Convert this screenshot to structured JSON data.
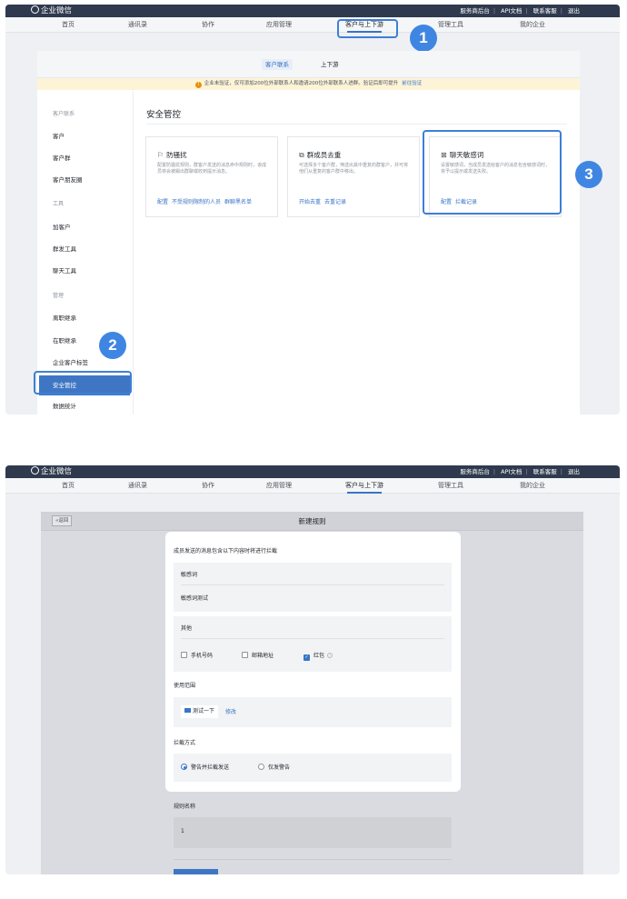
{
  "app": {
    "name": "企业微信",
    "top_links": [
      "服务商后台",
      "API文档",
      "联系客服",
      "退出"
    ],
    "nav": [
      "首页",
      "通讯录",
      "协作",
      "应用管理",
      "客户与上下游",
      "管理工具",
      "我的企业"
    ]
  },
  "screen1": {
    "subtabs": [
      "客户联系",
      "上下游"
    ],
    "warning": {
      "text": "企业未验证，仅可添加200位外部联系人和邀请200位外部联系人进群。验证后即可提升",
      "link": "前往验证",
      "icon": "warning-icon"
    },
    "sidebar": [
      {
        "label": "客户联系",
        "group": true
      },
      {
        "label": "客户",
        "group": false
      },
      {
        "label": "客户群",
        "group": false
      },
      {
        "label": "客户朋友圈",
        "group": false
      },
      {
        "label": "工具",
        "group": true
      },
      {
        "label": "加客户",
        "group": false
      },
      {
        "label": "群发工具",
        "group": false
      },
      {
        "label": "聊天工具",
        "group": false
      },
      {
        "label": "管理",
        "group": true
      },
      {
        "label": "离职继承",
        "group": false
      },
      {
        "label": "在职继承",
        "group": false
      },
      {
        "label": "企业客户标签",
        "group": false
      },
      {
        "label": "安全管控",
        "group": false,
        "active": true
      },
      {
        "label": "数据统计",
        "group": false
      }
    ],
    "content_title": "安全管控",
    "cards": [
      {
        "title": "防骚扰",
        "icon": "flag-icon",
        "desc": "配置防骚扰规则，群客户发送的消息命中规则时，该成员将会被踢出群聊或收到提示消息。",
        "links": [
          "配置",
          "不受规则限制的人员",
          "群聊黑名单"
        ]
      },
      {
        "title": "群成员去重",
        "icon": "group-icon",
        "desc": "可选择多个客户群，筛选出其中重复的群客户，并可将他们从重复的客户群中移出。",
        "links": [
          "开始去重",
          "去重记录"
        ]
      },
      {
        "title": "聊天敏感词",
        "icon": "chat-filter-icon",
        "desc": "设置敏感词，当成员发送给客户的消息包含敏感词时，将予以提示或发送失败。",
        "links": [
          "配置",
          "拦截记录"
        ]
      }
    ],
    "badges": [
      "1",
      "2",
      "3"
    ]
  },
  "screen2": {
    "back": "«返回",
    "title": "新建规则",
    "intercept_label": "成员发送的消息包含以下内容时将进行拦截",
    "sensitive_label": "敏感词",
    "sensitive_value": "敏感词测试",
    "other_label": "其他",
    "checkboxes": [
      {
        "label": "手机号码",
        "checked": false
      },
      {
        "label": "邮箱地址",
        "checked": false
      },
      {
        "label": "红包",
        "checked": true
      }
    ],
    "scope_label": "使用范围",
    "scope_tag": "测试一下",
    "scope_edit": "修改",
    "mode_label": "拦截方式",
    "modes": [
      {
        "label": "警告并拦截发送",
        "selected": true
      },
      {
        "label": "仅发警告",
        "selected": false
      }
    ],
    "rule_name_label": "规则名称",
    "rule_name_value": "1"
  }
}
